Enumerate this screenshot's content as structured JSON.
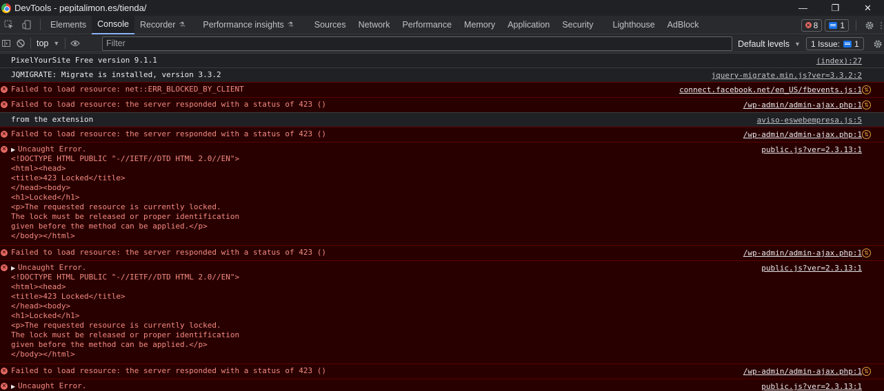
{
  "window": {
    "title": "DevTools - pepitalimon.es/tienda/",
    "controls": [
      "—",
      "❐",
      "✕"
    ]
  },
  "tabs": [
    {
      "label": "Elements"
    },
    {
      "label": "Console",
      "active": true
    },
    {
      "label": "Recorder",
      "experimental": true
    },
    {
      "label": "Performance insights",
      "experimental": true
    },
    {
      "label": "Sources"
    },
    {
      "label": "Network"
    },
    {
      "label": "Performance"
    },
    {
      "label": "Memory"
    },
    {
      "label": "Application"
    },
    {
      "label": "Security"
    },
    {
      "label": "Lighthouse"
    },
    {
      "label": "AdBlock"
    }
  ],
  "counts": {
    "errors": "8",
    "messages": "1"
  },
  "toolbar": {
    "context": "top",
    "filter_placeholder": "Filter",
    "levels": "Default levels",
    "issues": "1 Issue:",
    "issues_count": "1"
  },
  "colors": {
    "error_bg": "#290000",
    "error_text": "#f28b82",
    "accent": "#8ab4f8"
  },
  "messages": [
    {
      "type": "info",
      "text": "PixelYourSite Free version 9.1.1",
      "source": "(index):27"
    },
    {
      "type": "info",
      "text": "JQMIGRATE: Migrate is installed, version 3.3.2",
      "source": "jquery-migrate.min.js?ver=3.3.2:2"
    },
    {
      "type": "error",
      "text": "Failed to load resource: net::ERR_BLOCKED_BY_CLIENT",
      "source": "connect.facebook.net/en_US/fbevents.js:1",
      "network": true
    },
    {
      "type": "error",
      "text": "Failed to load resource: the server responded with a status of 423 ()",
      "source": "/wp-admin/admin-ajax.php:1",
      "network": true
    },
    {
      "type": "info",
      "text": "from the extension",
      "source": "aviso-eswebempresa.js:5"
    },
    {
      "type": "error",
      "text": "Failed to load resource: the server responded with a status of 423 ()",
      "source": "/wp-admin/admin-ajax.php:1",
      "network": true
    },
    {
      "type": "error",
      "expandable": true,
      "text": "Uncaught Error.\n<!DOCTYPE HTML PUBLIC \"-//IETF//DTD HTML 2.0//EN\">\n<html><head>\n<title>423 Locked</title>\n</head><body>\n<h1>Locked</h1>\n<p>The requested resource is currently locked.\nThe lock must be released or proper identification\ngiven before the method can be applied.</p>\n</body></html>",
      "source": "public.js?ver=2.3.13:1"
    },
    {
      "type": "error",
      "text": "Failed to load resource: the server responded with a status of 423 ()",
      "source": "/wp-admin/admin-ajax.php:1",
      "network": true
    },
    {
      "type": "error",
      "expandable": true,
      "text": "Uncaught Error.\n<!DOCTYPE HTML PUBLIC \"-//IETF//DTD HTML 2.0//EN\">\n<html><head>\n<title>423 Locked</title>\n</head><body>\n<h1>Locked</h1>\n<p>The requested resource is currently locked.\nThe lock must be released or proper identification\ngiven before the method can be applied.</p>\n</body></html>",
      "source": "public.js?ver=2.3.13:1"
    },
    {
      "type": "error",
      "text": "Failed to load resource: the server responded with a status of 423 ()",
      "source": "/wp-admin/admin-ajax.php:1",
      "network": true
    },
    {
      "type": "error",
      "expandable": true,
      "text": "Uncaught Error.",
      "source": "public.js?ver=2.3.13:1"
    }
  ]
}
